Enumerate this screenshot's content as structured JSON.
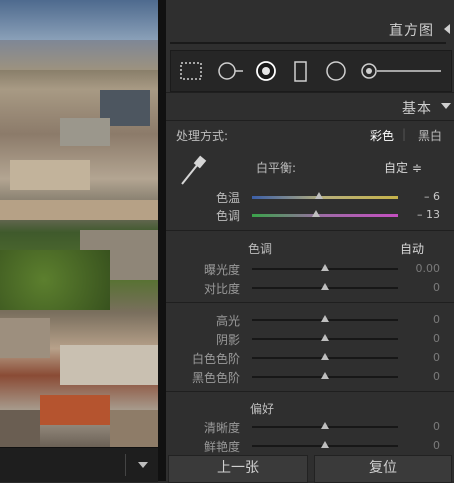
{
  "panel": {
    "histogram_title": "直方图",
    "basic_title": "基本",
    "treatment_label": "处理方式:",
    "treatment_color": "彩色",
    "treatment_bw": "黑白",
    "wb_label": "白平衡:",
    "wb_value": "自定 ≑",
    "temp_label": "色温",
    "temp_value": "– 6",
    "tint_label": "色调",
    "tint_value": "– 13",
    "tone_section": "色调",
    "tone_auto": "自动",
    "exposure_label": "曝光度",
    "exposure_value": "0.00",
    "contrast_label": "对比度",
    "contrast_value": "0",
    "highlights_label": "高光",
    "highlights_value": "0",
    "shadows_label": "阴影",
    "shadows_value": "0",
    "whites_label": "白色色阶",
    "whites_value": "0",
    "blacks_label": "黑色色阶",
    "blacks_value": "0",
    "presence_section": "偏好",
    "clarity_label": "清晰度",
    "clarity_value": "0",
    "vibrance_label": "鲜艳度",
    "vibrance_value": "0"
  },
  "bottom": {
    "prev_label": "上一张",
    "reset_label": "复位"
  },
  "icons": [
    "crop-overlay-icon",
    "spot-removal-icon",
    "red-eye-icon",
    "graduated-filter-icon",
    "radial-filter-icon",
    "adjustment-brush-icon"
  ],
  "colors": {
    "panel_bg": "#2f2f2f",
    "active_tool": "#ffffff"
  }
}
